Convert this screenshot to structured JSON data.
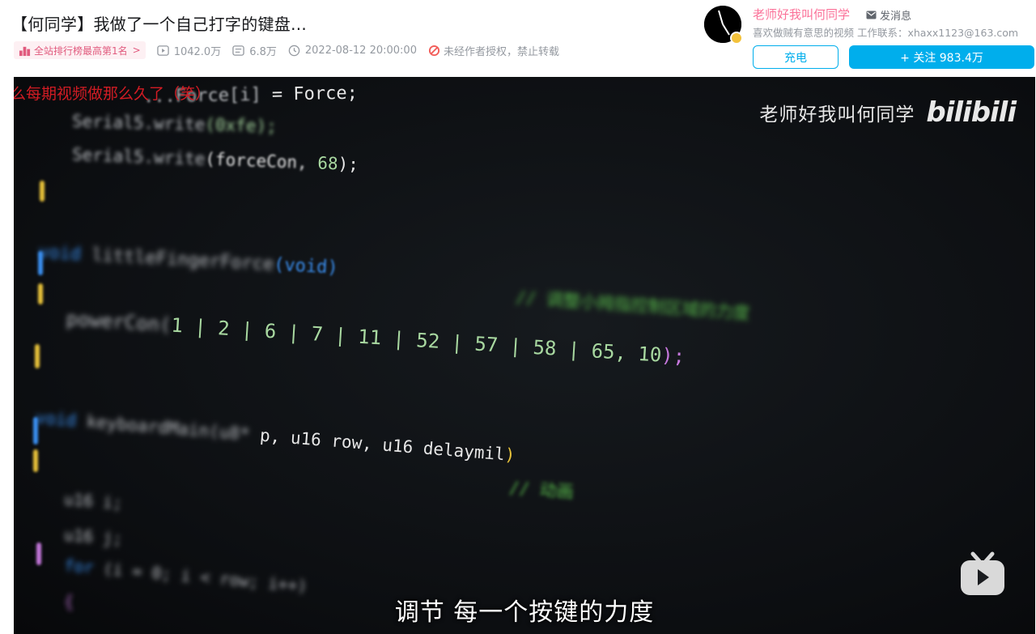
{
  "video": {
    "title": "【何同学】我做了一个自己打字的键盘...",
    "rank_badge": "全站排行榜最高第1名",
    "rank_chevron": ">",
    "views": "1042.0万",
    "danmaku": "6.8万",
    "publish_time": "2022-08-12 20:00:00",
    "copyright_notice": "未经作者授权，禁止转载"
  },
  "uploader": {
    "name": "老师好我叫何同学",
    "message_label": "发消息",
    "description": "喜欢做贼有意思的视频 工作联系：xhaxx1123@163.com",
    "charge_label": "充电",
    "follow_label": "+ 关注 983.4万"
  },
  "player": {
    "scrolling_danmaku": "么每期视频做那么久了（笑）",
    "watermark_name": "老师好我叫何同学",
    "watermark_logo": "bilibili",
    "subtitle": "调节 每一个按键的力度",
    "code": {
      "l1_a": "...Force[i]",
      "l1_b": " = Force;",
      "l2_a": "Serial5.write",
      "l2_b": "(0xfe);",
      "l3_a": "Serial5.write",
      "l3_b": "(forceCon, ",
      "l3_c": "68",
      "l3_d": ");",
      "l4_a": "void ",
      "l4_b": "littleFingerForce",
      "l4_c": "(void)",
      "l5": "// 调整小拇指控制区域的力度",
      "l6_a": "powerCon(",
      "l6_b": "1 | 2 | 6 | 7 | 11 | 52 | 57 | 58 | 65, 10",
      "l6_c": ");",
      "l7_a": "void ",
      "l7_b": "keyboardMain(u8* ",
      "l7_c": "p, u16 row, u16 delaymil",
      "l7_d": ")",
      "l8": "// 动画",
      "l9": "u16 i;",
      "l10": "u16 j;",
      "l11_a": "for ",
      "l11_b": "(i = 0; i < row; i++)",
      "l12": "{"
    }
  },
  "colors": {
    "accent_blue": "#00aeec",
    "uploader_pink": "#fb7299",
    "danmaku_red": "#d31c24"
  }
}
